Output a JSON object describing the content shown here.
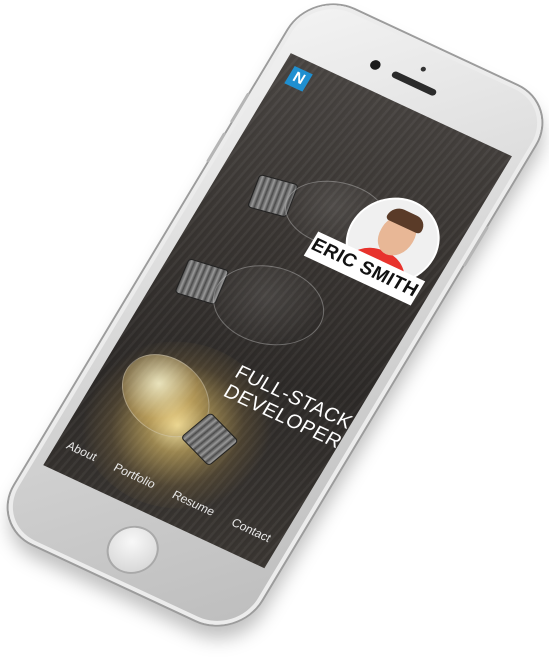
{
  "app": {
    "logo_letter": "N",
    "name": "ERIC SMITH",
    "headline_line1": "FULL-STACK",
    "headline_line2": "DEVELOPER"
  },
  "nav": {
    "items": [
      {
        "label": "About"
      },
      {
        "label": "Portfolio"
      },
      {
        "label": "Resume"
      },
      {
        "label": "Contact"
      }
    ]
  },
  "colors": {
    "logo_accent": "#1f8fd0",
    "shirt": "#e8322c",
    "name_tag_bg": "#ffffff",
    "phone_body": "#d9d9d9"
  },
  "icons": [
    "home-button-icon",
    "front-camera-icon",
    "earpiece-icon"
  ]
}
